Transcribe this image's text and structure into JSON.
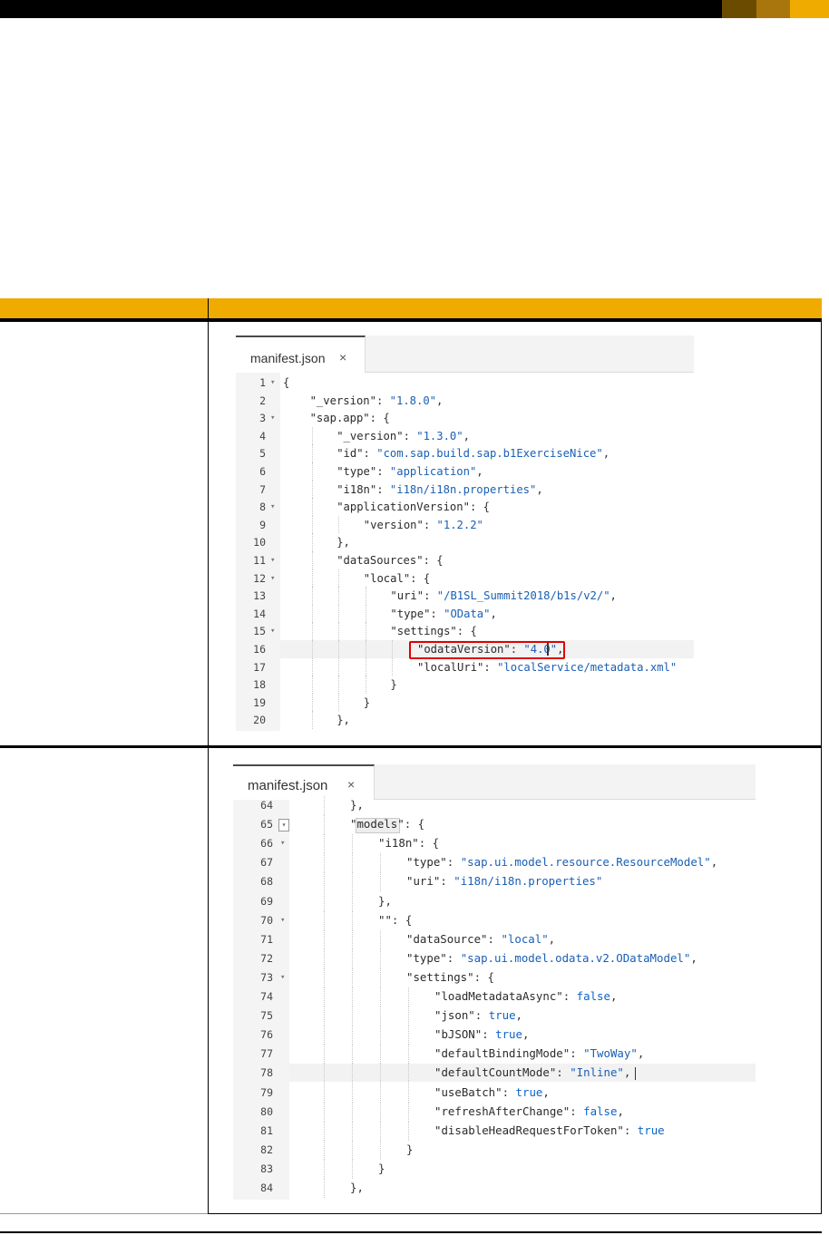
{
  "brand": {
    "colors": [
      "#6b4b00",
      "#a8760c",
      "#f0ab00"
    ]
  },
  "table_accent": "#f0ab00",
  "editor1": {
    "tab_label": "manifest.json",
    "close_glyph": "×",
    "lines": [
      {
        "n": "1",
        "fold": true,
        "indent": 0,
        "tokens": [
          [
            "p",
            "{"
          ]
        ]
      },
      {
        "n": "2",
        "fold": false,
        "indent": 1,
        "tokens": [
          [
            "k",
            "\"_version\""
          ],
          [
            "p",
            ": "
          ],
          [
            "s",
            "\"1.8.0\""
          ],
          [
            "p",
            ","
          ]
        ]
      },
      {
        "n": "3",
        "fold": true,
        "indent": 1,
        "tokens": [
          [
            "k",
            "\"sap.app\""
          ],
          [
            "p",
            ": {"
          ]
        ]
      },
      {
        "n": "4",
        "fold": false,
        "indent": 2,
        "tokens": [
          [
            "k",
            "\"_version\""
          ],
          [
            "p",
            ": "
          ],
          [
            "s",
            "\"1.3.0\""
          ],
          [
            "p",
            ","
          ]
        ]
      },
      {
        "n": "5",
        "fold": false,
        "indent": 2,
        "tokens": [
          [
            "k",
            "\"id\""
          ],
          [
            "p",
            ": "
          ],
          [
            "s",
            "\"com.sap.build.sap.b1ExerciseNice\""
          ],
          [
            "p",
            ","
          ]
        ]
      },
      {
        "n": "6",
        "fold": false,
        "indent": 2,
        "tokens": [
          [
            "k",
            "\"type\""
          ],
          [
            "p",
            ": "
          ],
          [
            "s",
            "\"application\""
          ],
          [
            "p",
            ","
          ]
        ]
      },
      {
        "n": "7",
        "fold": false,
        "indent": 2,
        "tokens": [
          [
            "k",
            "\"i18n\""
          ],
          [
            "p",
            ": "
          ],
          [
            "s",
            "\"i18n/i18n.properties\""
          ],
          [
            "p",
            ","
          ]
        ]
      },
      {
        "n": "8",
        "fold": true,
        "indent": 2,
        "tokens": [
          [
            "k",
            "\"applicationVersion\""
          ],
          [
            "p",
            ": {"
          ]
        ]
      },
      {
        "n": "9",
        "fold": false,
        "indent": 3,
        "tokens": [
          [
            "k",
            "\"version\""
          ],
          [
            "p",
            ": "
          ],
          [
            "s",
            "\"1.2.2\""
          ]
        ]
      },
      {
        "n": "10",
        "fold": false,
        "indent": 2,
        "tokens": [
          [
            "p",
            "},"
          ]
        ]
      },
      {
        "n": "11",
        "fold": true,
        "indent": 2,
        "tokens": [
          [
            "k",
            "\"dataSources\""
          ],
          [
            "p",
            ": {"
          ]
        ]
      },
      {
        "n": "12",
        "fold": true,
        "indent": 3,
        "tokens": [
          [
            "k",
            "\"local\""
          ],
          [
            "p",
            ": {"
          ]
        ]
      },
      {
        "n": "13",
        "fold": false,
        "indent": 4,
        "tokens": [
          [
            "k",
            "\"uri\""
          ],
          [
            "p",
            ": "
          ],
          [
            "s",
            "\"/B1SL_Summit2018/b1s/v2/\""
          ],
          [
            "p",
            ","
          ]
        ]
      },
      {
        "n": "14",
        "fold": false,
        "indent": 4,
        "tokens": [
          [
            "k",
            "\"type\""
          ],
          [
            "p",
            ": "
          ],
          [
            "s",
            "\"OData\""
          ],
          [
            "p",
            ","
          ]
        ]
      },
      {
        "n": "15",
        "fold": true,
        "indent": 4,
        "tokens": [
          [
            "k",
            "\"settings\""
          ],
          [
            "p",
            ": {"
          ]
        ]
      },
      {
        "n": "16",
        "fold": false,
        "indent": 5,
        "tokens": [
          [
            "k",
            "\"odataVersion\""
          ],
          [
            "p",
            ": "
          ],
          [
            "s",
            "\"4.0\""
          ],
          [
            "p",
            ","
          ]
        ]
      },
      {
        "n": "17",
        "fold": false,
        "indent": 5,
        "tokens": [
          [
            "k",
            "\"localUri\""
          ],
          [
            "p",
            ": "
          ],
          [
            "s",
            "\"localService/metadata.xml\""
          ]
        ]
      },
      {
        "n": "18",
        "fold": false,
        "indent": 4,
        "tokens": [
          [
            "p",
            "}"
          ]
        ]
      },
      {
        "n": "19",
        "fold": false,
        "indent": 3,
        "tokens": [
          [
            "p",
            "}"
          ]
        ]
      },
      {
        "n": "20",
        "fold": false,
        "indent": 2,
        "tokens": [
          [
            "p",
            "},"
          ]
        ]
      }
    ]
  },
  "editor2": {
    "tab_label": "manifest.json",
    "close_glyph": "×",
    "lines": [
      {
        "n": "64",
        "fold": false,
        "indent": 2,
        "tokens": [
          [
            "p",
            "},"
          ]
        ]
      },
      {
        "n": "65",
        "fold": "box",
        "indent": 2,
        "tokens": [
          [
            "k",
            "\"models\""
          ],
          [
            "p",
            ": {"
          ]
        ]
      },
      {
        "n": "66",
        "fold": true,
        "indent": 3,
        "tokens": [
          [
            "k",
            "\"i18n\""
          ],
          [
            "p",
            ": {"
          ]
        ]
      },
      {
        "n": "67",
        "fold": false,
        "indent": 4,
        "tokens": [
          [
            "k",
            "\"type\""
          ],
          [
            "p",
            ": "
          ],
          [
            "s",
            "\"sap.ui.model.resource.ResourceModel\""
          ],
          [
            "p",
            ","
          ]
        ]
      },
      {
        "n": "68",
        "fold": false,
        "indent": 4,
        "tokens": [
          [
            "k",
            "\"uri\""
          ],
          [
            "p",
            ": "
          ],
          [
            "s",
            "\"i18n/i18n.properties\""
          ]
        ]
      },
      {
        "n": "69",
        "fold": false,
        "indent": 3,
        "tokens": [
          [
            "p",
            "},"
          ]
        ]
      },
      {
        "n": "70",
        "fold": true,
        "indent": 3,
        "tokens": [
          [
            "k",
            "\"\""
          ],
          [
            "p",
            ": {"
          ]
        ]
      },
      {
        "n": "71",
        "fold": false,
        "indent": 4,
        "tokens": [
          [
            "k",
            "\"dataSource\""
          ],
          [
            "p",
            ": "
          ],
          [
            "s",
            "\"local\""
          ],
          [
            "p",
            ","
          ]
        ]
      },
      {
        "n": "72",
        "fold": false,
        "indent": 4,
        "tokens": [
          [
            "k",
            "\"type\""
          ],
          [
            "p",
            ": "
          ],
          [
            "s",
            "\"sap.ui.model.odata.v2.ODataModel\""
          ],
          [
            "p",
            ","
          ]
        ]
      },
      {
        "n": "73",
        "fold": true,
        "indent": 4,
        "tokens": [
          [
            "k",
            "\"settings\""
          ],
          [
            "p",
            ": {"
          ]
        ]
      },
      {
        "n": "74",
        "fold": false,
        "indent": 5,
        "tokens": [
          [
            "k",
            "\"loadMetadataAsync\""
          ],
          [
            "p",
            ": "
          ],
          [
            "b",
            "false"
          ],
          [
            "p",
            ","
          ]
        ]
      },
      {
        "n": "75",
        "fold": false,
        "indent": 5,
        "tokens": [
          [
            "k",
            "\"json\""
          ],
          [
            "p",
            ": "
          ],
          [
            "b",
            "true"
          ],
          [
            "p",
            ","
          ]
        ]
      },
      {
        "n": "76",
        "fold": false,
        "indent": 5,
        "tokens": [
          [
            "k",
            "\"bJSON\""
          ],
          [
            "p",
            ": "
          ],
          [
            "b",
            "true"
          ],
          [
            "p",
            ","
          ]
        ]
      },
      {
        "n": "77",
        "fold": false,
        "indent": 5,
        "tokens": [
          [
            "k",
            "\"defaultBindingMode\""
          ],
          [
            "p",
            ": "
          ],
          [
            "s",
            "\"TwoWay\""
          ],
          [
            "p",
            ","
          ]
        ]
      },
      {
        "n": "78",
        "fold": false,
        "indent": 5,
        "tokens": [
          [
            "k",
            "\"defaultCountMode\""
          ],
          [
            "p",
            ": "
          ],
          [
            "s",
            "\"Inline\""
          ],
          [
            "p",
            ","
          ]
        ]
      },
      {
        "n": "79",
        "fold": false,
        "indent": 5,
        "tokens": [
          [
            "k",
            "\"useBatch\""
          ],
          [
            "p",
            ": "
          ],
          [
            "b",
            "true"
          ],
          [
            "p",
            ","
          ]
        ]
      },
      {
        "n": "80",
        "fold": false,
        "indent": 5,
        "tokens": [
          [
            "k",
            "\"refreshAfterChange\""
          ],
          [
            "p",
            ": "
          ],
          [
            "b",
            "false"
          ],
          [
            "p",
            ","
          ]
        ]
      },
      {
        "n": "81",
        "fold": false,
        "indent": 5,
        "tokens": [
          [
            "k",
            "\"disableHeadRequestForToken\""
          ],
          [
            "p",
            ": "
          ],
          [
            "b",
            "true"
          ]
        ]
      },
      {
        "n": "82",
        "fold": false,
        "indent": 4,
        "tokens": [
          [
            "p",
            "}"
          ]
        ]
      },
      {
        "n": "83",
        "fold": false,
        "indent": 3,
        "tokens": [
          [
            "p",
            "}"
          ]
        ]
      },
      {
        "n": "84",
        "fold": false,
        "indent": 2,
        "tokens": [
          [
            "p",
            "},"
          ]
        ]
      }
    ]
  }
}
